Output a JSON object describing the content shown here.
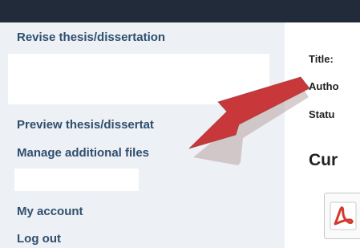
{
  "sidebar": {
    "links": [
      {
        "label": "Revise thesis/dissertation"
      },
      {
        "label": "Preview thesis/dissertat"
      },
      {
        "label": "Manage additional files"
      },
      {
        "label": "My account"
      },
      {
        "label": "Log out"
      }
    ]
  },
  "main": {
    "meta": {
      "title_label": "Title:",
      "author_label": "Autho",
      "status_label": "Statu"
    },
    "section_heading": "Cur",
    "file_icon": "pdf-file-icon"
  },
  "annotation": {
    "arrow_icon": "red-pointer-arrow-icon",
    "arrow_color": "#c8383a",
    "shadow_color": "#b9a6a6"
  },
  "colors": {
    "topbar": "#222b3a",
    "sidebar_background": "#edf0f4",
    "link_text": "#2f4f6f"
  }
}
